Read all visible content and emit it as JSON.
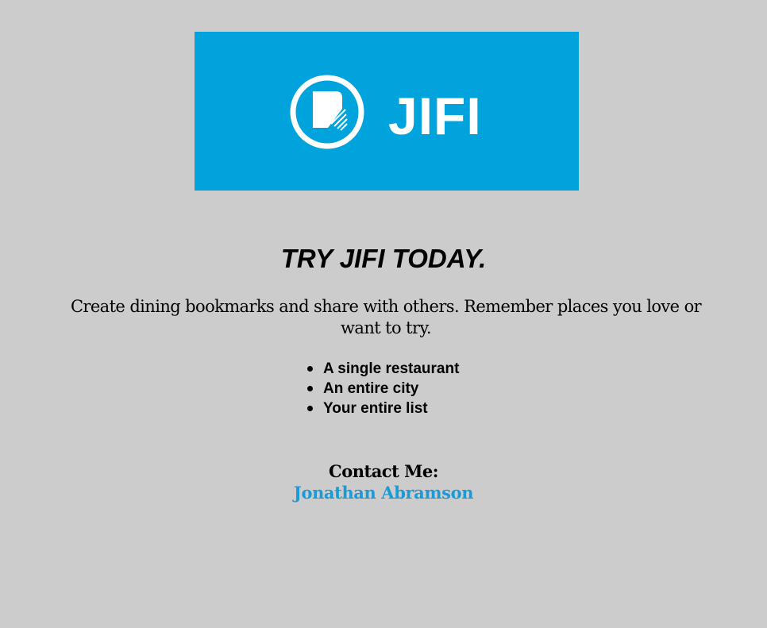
{
  "logo": {
    "wordmark": "JIFI",
    "icon": "bookmark-circle-icon",
    "background_color": "#00a3dc",
    "foreground_color": "#ffffff"
  },
  "headline": "TRY JIFI TODAY.",
  "tagline": "Create dining bookmarks and share with others. Remember places you love or want to try.",
  "features": [
    "A single restaurant",
    "An entire city",
    "Your entire list"
  ],
  "contact": {
    "label": "Contact Me:",
    "name": "Jonathan Abramson",
    "link_color": "#1a9ad6"
  },
  "colors": {
    "page_background": "#cccccc",
    "text": "#000000"
  }
}
